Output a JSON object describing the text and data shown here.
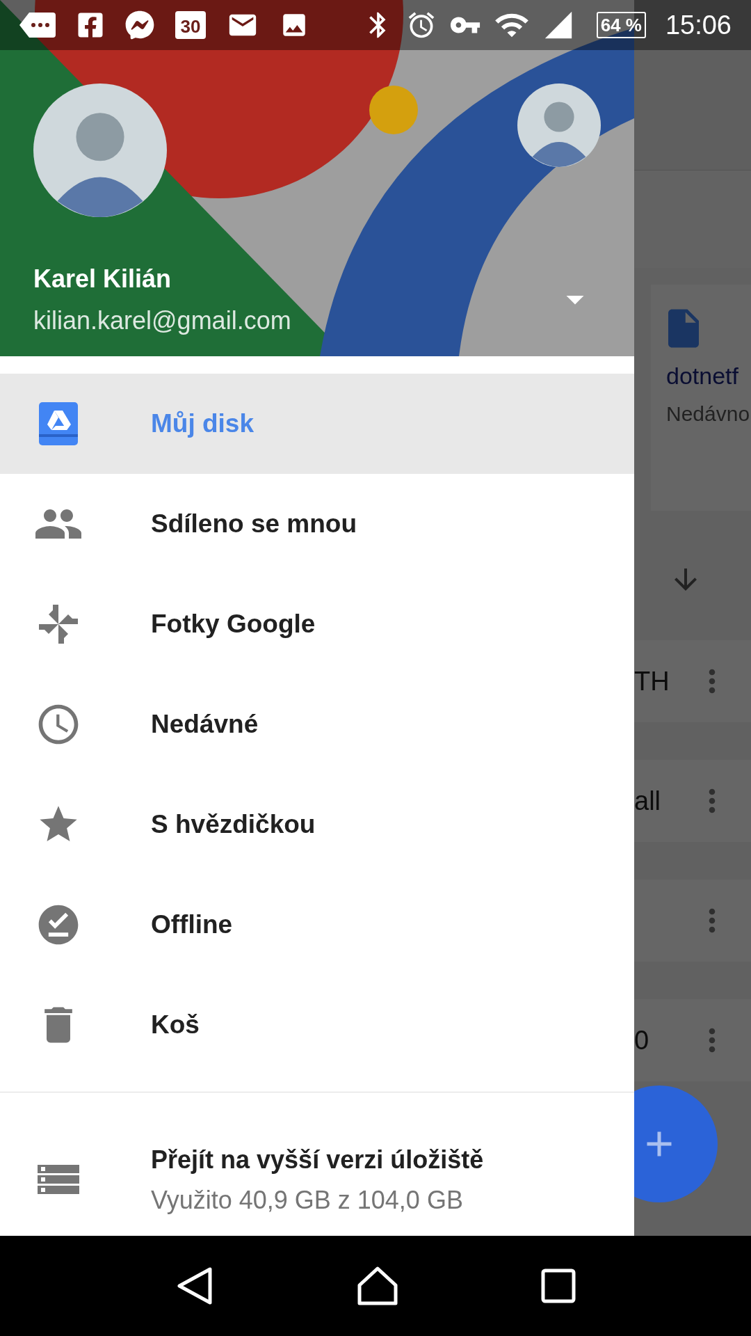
{
  "status_bar": {
    "calendar_day": "30",
    "battery": "64 %",
    "time": "15:06"
  },
  "account": {
    "name": "Karel Kilián",
    "email": "kilian.karel@gmail.com"
  },
  "nav_items": [
    {
      "kind": "drive",
      "label": "Můj disk",
      "selected": true
    },
    {
      "kind": "shared",
      "label": "Sdíleno se mnou",
      "selected": false
    },
    {
      "kind": "photos",
      "label": "Fotky Google",
      "selected": false
    },
    {
      "kind": "recent",
      "label": "Nedávné",
      "selected": false
    },
    {
      "kind": "starred",
      "label": "S hvězdičkou",
      "selected": false
    },
    {
      "kind": "offline",
      "label": "Offline",
      "selected": false
    },
    {
      "kind": "trash",
      "label": "Koš",
      "selected": false
    }
  ],
  "storage": {
    "title": "Přejít na vyšší verzi úložiště",
    "usage": "Využito 40,9 GB z 104,0 GB"
  },
  "background": {
    "card": {
      "title": "dotnetf",
      "subtitle": "Nedávno"
    },
    "rows": [
      {
        "kind": "named",
        "text": "TH"
      },
      {
        "kind": "named",
        "text": "all"
      },
      {
        "kind": "blank"
      },
      {
        "kind": "named",
        "text": "0"
      }
    ]
  }
}
